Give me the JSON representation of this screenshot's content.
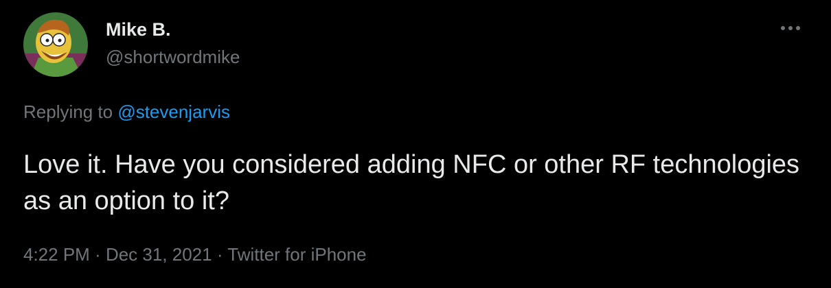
{
  "author": {
    "display_name": "Mike B.",
    "handle": "@shortwordmike",
    "avatar_icon": "cartoon-avatar-icon"
  },
  "more_menu": {
    "icon": "more-horizontal-icon"
  },
  "reply_context": {
    "prefix": "Replying to ",
    "mention": "@stevenjarvis"
  },
  "tweet": {
    "text": "Love it. Have you considered adding NFC or other RF technologies as an option to it?"
  },
  "meta": {
    "time": "4:22 PM",
    "separator": " · ",
    "date": "Dec 31, 2021",
    "source": "Twitter for iPhone"
  },
  "colors": {
    "background": "#000000",
    "primary_text": "#e7e9ea",
    "secondary_text": "#71767b",
    "link": "#1d9bf0"
  }
}
